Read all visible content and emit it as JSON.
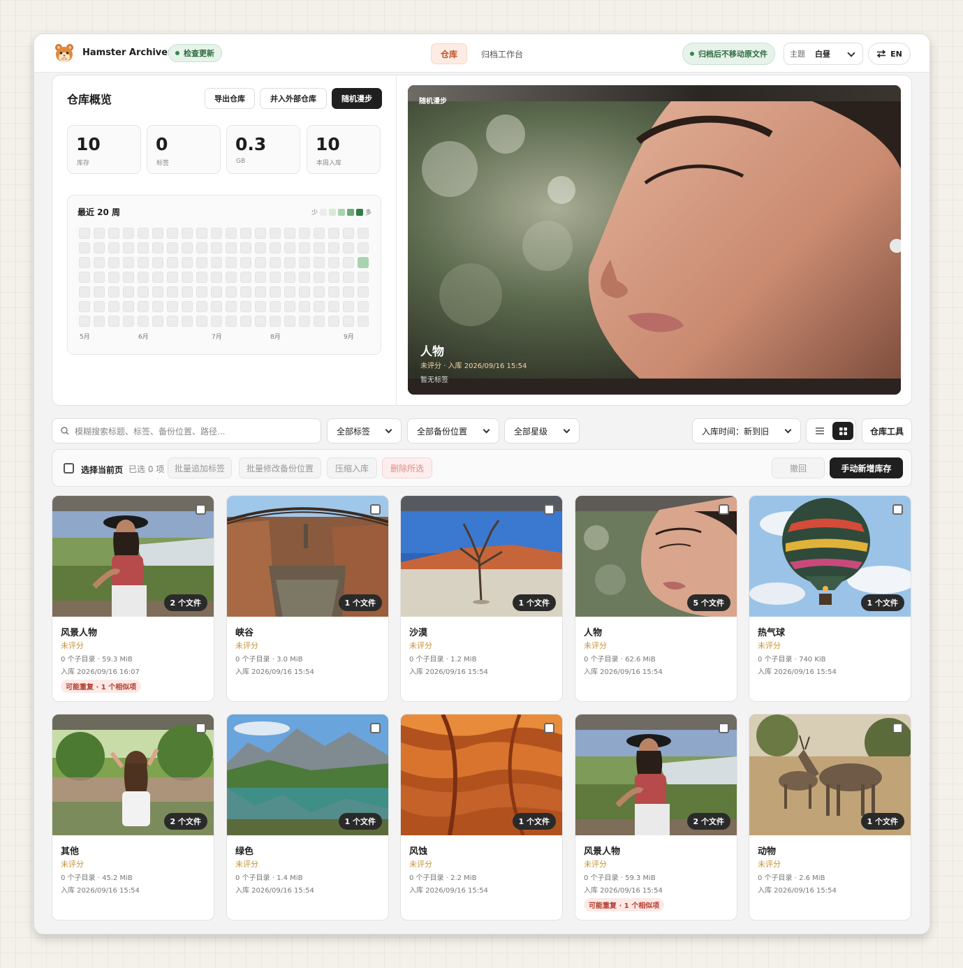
{
  "app": {
    "name": "Hamster Archiver",
    "update_label": "检查更新"
  },
  "nav": {
    "tabs": [
      {
        "label": "仓库"
      },
      {
        "label": "归档工作台"
      }
    ]
  },
  "header": {
    "no_move_label": "归档后不移动原文件",
    "theme_label": "主题",
    "theme_value": "白昼",
    "lang_label": "EN"
  },
  "overview": {
    "title": "仓库概览",
    "export_label": "导出仓库",
    "merge_label": "并入外部仓库",
    "random_label": "随机漫步",
    "stats": [
      {
        "value": "10",
        "label": "库存"
      },
      {
        "value": "0",
        "label": "标签"
      },
      {
        "value": "0.3",
        "label": "GB"
      },
      {
        "value": "10",
        "label": "本周入库"
      }
    ],
    "heatmap": {
      "title": "最近 20 周",
      "legend_less": "少",
      "legend_more": "多",
      "months": [
        "5月",
        "6月",
        "7月",
        "8月",
        "9月"
      ],
      "weeks": 20,
      "days": 7,
      "active": [
        {
          "week": 19,
          "day": 2,
          "level": 2
        }
      ],
      "colors": [
        "#ececec",
        "#d7ead9",
        "#a8d3b0",
        "#6aa97a",
        "#2f7d47"
      ]
    }
  },
  "random_walk": {
    "label": "随机漫步",
    "title": "人物",
    "meta": "未评分 · 入库 2026/09/16 15:54",
    "tags": "暂无标签"
  },
  "filters": {
    "search_placeholder": "模糊搜索标题、标签、备份位置、路径...",
    "tags": "全部标签",
    "backup": "全部备份位置",
    "rating": "全部星级",
    "sort": "入库时间：新到旧",
    "tools": "仓库工具"
  },
  "bulk": {
    "select_page": "选择当前页",
    "selected": "已选 0 项",
    "add_tags": "批量追加标签",
    "edit_backup": "批量修改备份位置",
    "compress": "压缩入库",
    "delete": "删除所选",
    "undo": "撤回",
    "add_manual": "手动新增库存"
  },
  "cards": [
    {
      "title": "风景人物",
      "rating": "未评分",
      "meta": "0 个子目录 · 59.3 MiB",
      "date": "入库 2026/09/16 16:07",
      "files": "2 个文件",
      "dup": "可能重复 · 1 个相似项",
      "thumb": "portrait-landscape"
    },
    {
      "title": "峡谷",
      "rating": "未评分",
      "meta": "0 个子目录 · 3.0 MiB",
      "date": "入库 2026/09/16 15:54",
      "files": "1 个文件",
      "dup": "",
      "thumb": "canyon"
    },
    {
      "title": "沙漠",
      "rating": "未评分",
      "meta": "0 个子目录 · 1.2 MiB",
      "date": "入库 2026/09/16 15:54",
      "files": "1 个文件",
      "dup": "",
      "thumb": "desert"
    },
    {
      "title": "人物",
      "rating": "未评分",
      "meta": "0 个子目录 · 62.6 MiB",
      "date": "入库 2026/09/16 15:54",
      "files": "5 个文件",
      "dup": "",
      "thumb": "face"
    },
    {
      "title": "热气球",
      "rating": "未评分",
      "meta": "0 个子目录 · 740 KiB",
      "date": "入库 2026/09/16 15:54",
      "files": "1 个文件",
      "dup": "",
      "thumb": "balloon"
    },
    {
      "title": "其他",
      "rating": "未评分",
      "meta": "0 个子目录 · 45.2 MiB",
      "date": "入库 2026/09/16 15:54",
      "files": "2 个文件",
      "dup": "",
      "thumb": "girl-trees"
    },
    {
      "title": "绿色",
      "rating": "未评分",
      "meta": "0 个子目录 · 1.4 MiB",
      "date": "入库 2026/09/16 15:54",
      "files": "1 个文件",
      "dup": "",
      "thumb": "lake"
    },
    {
      "title": "风蚀",
      "rating": "未评分",
      "meta": "0 个子目录 · 2.2 MiB",
      "date": "入库 2026/09/16 15:54",
      "files": "1 个文件",
      "dup": "",
      "thumb": "sandstone"
    },
    {
      "title": "风景人物",
      "rating": "未评分",
      "meta": "0 个子目录 · 59.3 MiB",
      "date": "入库 2026/09/16 15:54",
      "files": "2 个文件",
      "dup": "可能重复 · 1 个相似项",
      "thumb": "portrait-landscape"
    },
    {
      "title": "动物",
      "rating": "未评分",
      "meta": "0 个子目录 · 2.6 MiB",
      "date": "入库 2026/09/16 15:54",
      "files": "1 个文件",
      "dup": "",
      "thumb": "antelope"
    }
  ]
}
